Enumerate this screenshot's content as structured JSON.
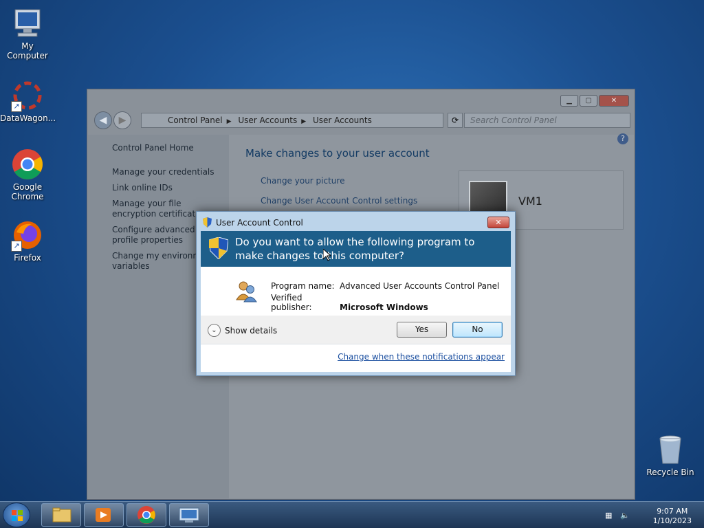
{
  "desktop": {
    "icons": [
      {
        "label": "My Computer"
      },
      {
        "label": "DataWagon..."
      },
      {
        "label": "Google Chrome"
      },
      {
        "label": "Firefox"
      },
      {
        "label": "Recycle Bin"
      }
    ]
  },
  "explorer": {
    "breadcrumb": [
      "Control Panel",
      "User Accounts",
      "User Accounts"
    ],
    "search_placeholder": "Search Control Panel",
    "sidebar": {
      "home": "Control Panel Home",
      "items": [
        "Manage your credentials",
        "Link online IDs",
        "Manage your file encryption certificates",
        "Configure advanced user profile properties",
        "Change my environment variables"
      ]
    },
    "main": {
      "title": "Make changes to your user account",
      "links": [
        "Change your picture",
        "Change User Account Control settings"
      ],
      "user_name": "VM1",
      "partial_text": "d."
    }
  },
  "uac": {
    "title": "User Account Control",
    "question": "Do you want to allow the following program to make changes to this computer?",
    "program_name_label": "Program name:",
    "program_name": "Advanced User Accounts Control Panel",
    "publisher_label": "Verified publisher:",
    "publisher": "Microsoft Windows",
    "show_details": "Show details",
    "yes_label": "Yes",
    "no_label": "No",
    "change_link": "Change when these notifications appear"
  },
  "taskbar": {
    "time": "9:07 AM",
    "date": "1/10/2023"
  },
  "colors": {
    "uac_banner": "#1d5e8a",
    "desktop": "#1b4f8f",
    "link": "#1b4fa0"
  }
}
